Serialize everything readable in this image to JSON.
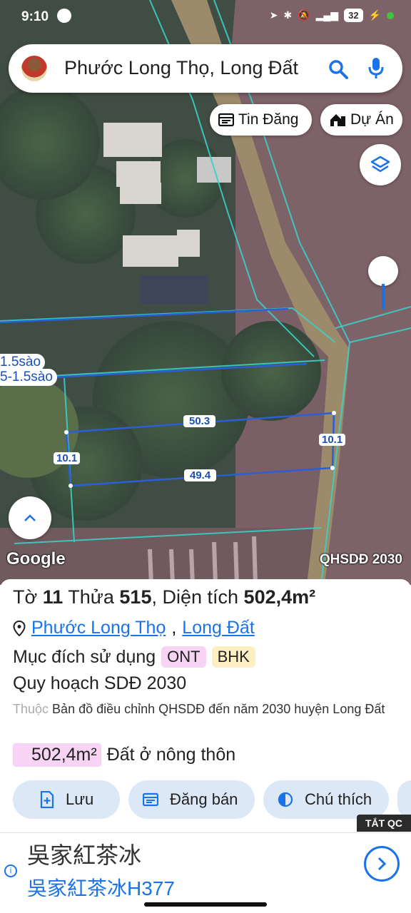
{
  "status_bar": {
    "time": "9:10",
    "battery": "32"
  },
  "search": {
    "query": "Phước Long Thọ, Long Đất"
  },
  "chips": {
    "listings": "Tin Đăng",
    "projects": "Dự Án"
  },
  "map": {
    "labels_left": [
      "1.5sào",
      "5-1.5sào"
    ],
    "dimensions": {
      "top": "50.3",
      "bottom": "49.4",
      "left": "10.1",
      "right": "10.1"
    },
    "attribution": "Google",
    "layer_label": "QHSDĐ 2030"
  },
  "parcel": {
    "title_sheet_label": "Tờ",
    "sheet": "11",
    "title_lot_label": "Thửa",
    "lot": "515",
    "title_area_label": ", Diện tích",
    "area": "502,4m²",
    "commune": "Phước Long Thọ",
    "district": "Long Đất",
    "purpose_label": "Mục đích sử dụng",
    "purpose_tags": [
      "ONT",
      "BHK"
    ],
    "plan_title": "Quy hoạch SDĐ 2030",
    "plan_prefix": "Thuộc",
    "plan_desc": "Bản đồ điều chỉnh QHSDĐ đến năm 2030 huyện Long Đất",
    "area_badge": "502,4m²",
    "land_type": "Đất ở nông thôn"
  },
  "actions": {
    "save": "Lưu",
    "post_sale": "Đăng bán",
    "legend": "Chú thích"
  },
  "ad": {
    "close_label": "TẮT QC",
    "title": "吳家紅茶冰",
    "subtitle": "吳家紅茶冰H377"
  }
}
